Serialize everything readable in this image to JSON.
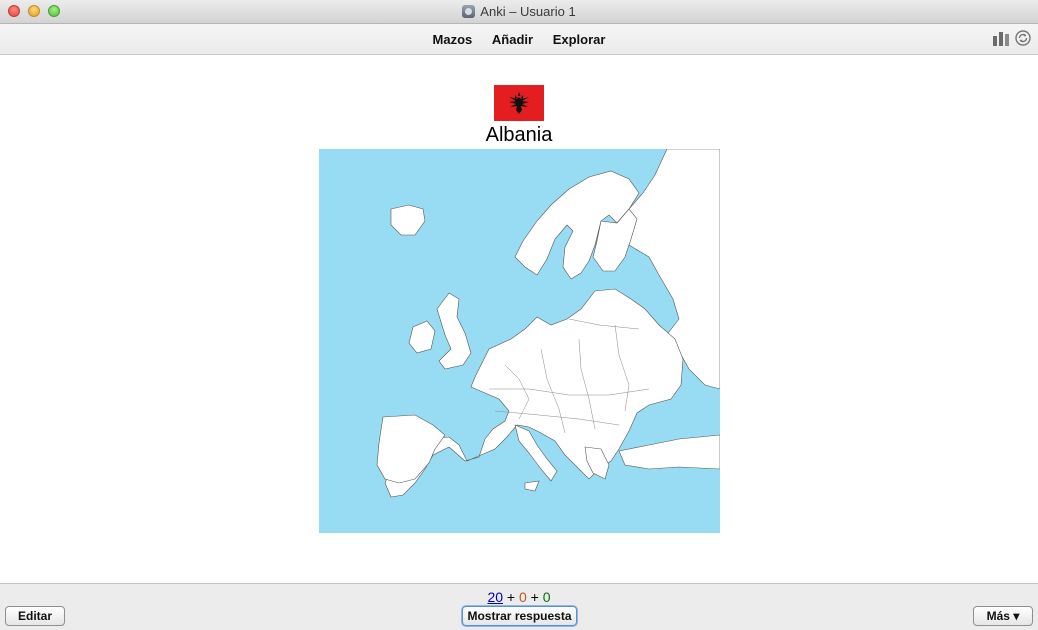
{
  "window": {
    "title": "Anki – Usuario 1"
  },
  "toolbar": {
    "nav": [
      "Mazos",
      "Añadir",
      "Explorar"
    ],
    "icons": [
      "stats-icon",
      "sync-icon"
    ]
  },
  "card": {
    "country": "Albania",
    "flag_icon": "albania-flag-icon",
    "flag_color": "#e41e20",
    "sea_color": "#97dcf2"
  },
  "counts": {
    "new": "20",
    "plus1": "+",
    "learn": "0",
    "plus2": "+",
    "review": "0"
  },
  "bottom": {
    "edit_label": "Editar",
    "show_answer_label": "Mostrar respuesta",
    "more_label": "Más ▾"
  }
}
